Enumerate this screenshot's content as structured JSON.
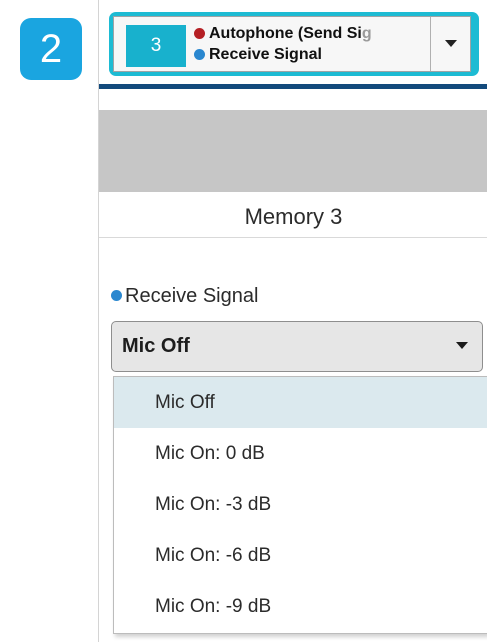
{
  "step": {
    "number": "2"
  },
  "memory_selector": {
    "number": "3",
    "signals": [
      {
        "dot": "red-dot-icon",
        "dot_color": "#b51f24",
        "label": "Autophone (Send Si",
        "faded_tail": "g"
      },
      {
        "dot": "blue-dot-icon",
        "dot_color": "#2a87cf",
        "label": "Receive Signal",
        "faded_tail": ""
      }
    ]
  },
  "memory_title": "Memory 3",
  "receive_signal": {
    "label": "Receive Signal",
    "dot_color": "#2a87cf",
    "selected": "Mic Off",
    "options": [
      "Mic Off",
      "Mic On: 0 dB",
      "Mic On: -3 dB",
      "Mic On: -6 dB",
      "Mic On: -9 dB"
    ],
    "highlighted_index": 0
  },
  "colors": {
    "accent_cyan": "#1dbbd3",
    "step_blue": "#1aa5e0",
    "header_rule": "#134a7c",
    "option_highlight": "#dbe9ee"
  }
}
